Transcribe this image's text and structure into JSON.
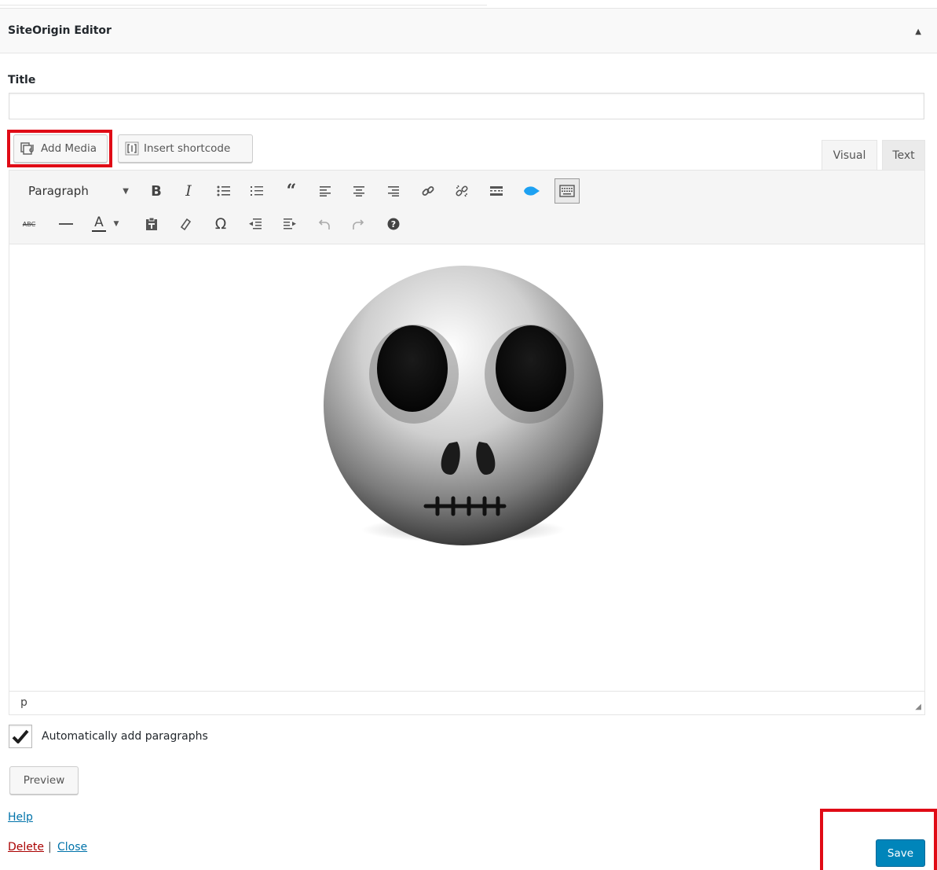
{
  "header": {
    "title": "SiteOrigin Editor",
    "toggle_icon": "triangle-up-icon"
  },
  "form": {
    "title_label": "Title",
    "title_value": "",
    "title_placeholder": ""
  },
  "media_buttons": {
    "add_media": "Add Media",
    "insert_shortcode": "Insert shortcode"
  },
  "tabs": {
    "visual": "Visual",
    "text": "Text",
    "active": "text"
  },
  "toolbar": {
    "format_selected": "Paragraph",
    "row1_icons": [
      "bold-icon",
      "italic-icon",
      "bullet-list-icon",
      "numbered-list-icon",
      "blockquote-icon",
      "align-left-icon",
      "align-center-icon",
      "align-right-icon",
      "link-icon",
      "unlink-icon",
      "read-more-icon",
      "extension-icon",
      "toolbar-toggle-icon"
    ],
    "row2_icons": [
      "strikethrough-icon",
      "horizontal-line-icon",
      "text-color-icon",
      "paste-as-text-icon",
      "clear-formatting-icon",
      "special-character-icon",
      "outdent-icon",
      "indent-icon",
      "undo-icon",
      "redo-icon",
      "help-icon"
    ],
    "bold": "B",
    "italic": "I",
    "strike": "ABC",
    "text_color": "A",
    "omega": "Ω"
  },
  "editor": {
    "image": "skull-emoji-image",
    "status_path": "p"
  },
  "options": {
    "auto_paragraphs_label": "Automatically add paragraphs",
    "auto_paragraphs_checked": true
  },
  "actions": {
    "preview": "Preview",
    "help": "Help",
    "delete": "Delete",
    "separator": "|",
    "close": "Close",
    "save": "Save"
  },
  "colors": {
    "highlight": "#e00b16",
    "primary": "#0085ba",
    "link": "#0073aa",
    "delete": "#aa0000"
  }
}
